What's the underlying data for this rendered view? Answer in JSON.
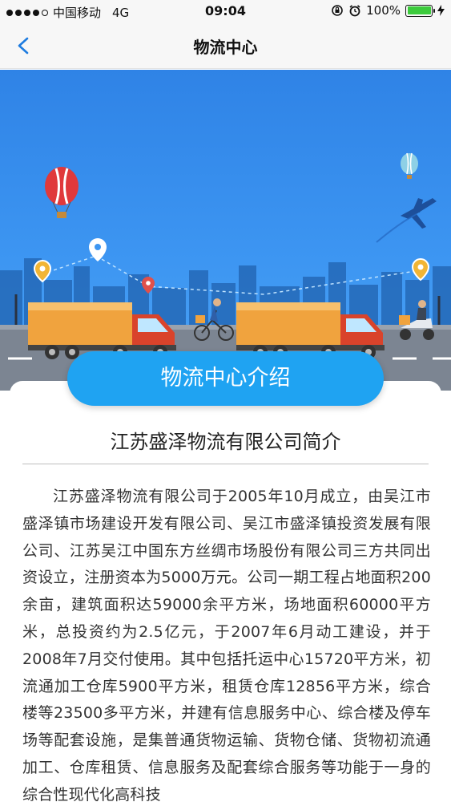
{
  "status_bar": {
    "carrier": "中国移动",
    "network": "4G",
    "time": "09:04",
    "battery": "100%"
  },
  "nav": {
    "title": "物流中心"
  },
  "intro_button": {
    "label": "物流中心介绍"
  },
  "card": {
    "heading": "江苏盛泽物流有限公司简介",
    "body": "江苏盛泽物流有限公司于2005年10月成立，由吴江市盛泽镇市场建设开发有限公司、吴江市盛泽镇投资发展有限公司、江苏吴江中国东方丝绸市场股份有限公司三方共同出资设立，注册资本为5000万元。公司一期工程占地面积200余亩，建筑面积达59000余平方米，场地面积60000平方米，总投资约为2.5亿元，于2007年6月动工建设，并于2008年7月交付使用。其中包括托运中心15720平方米，初流通加工仓库5900平方米，租赁仓库12856平方米，综合楼等23500多平方米，并建有信息服务中心、综合楼及停车场等配套设施，是集普通货物运输、货物仓储、货物初流通加工、仓库租赁、信息服务及配套综合服务等功能于一身的综合性现代化高科技"
  },
  "colors": {
    "accent": "#1fa3f2",
    "banner_sky": "#3d96f2",
    "back_arrow": "#1e7ce0"
  }
}
